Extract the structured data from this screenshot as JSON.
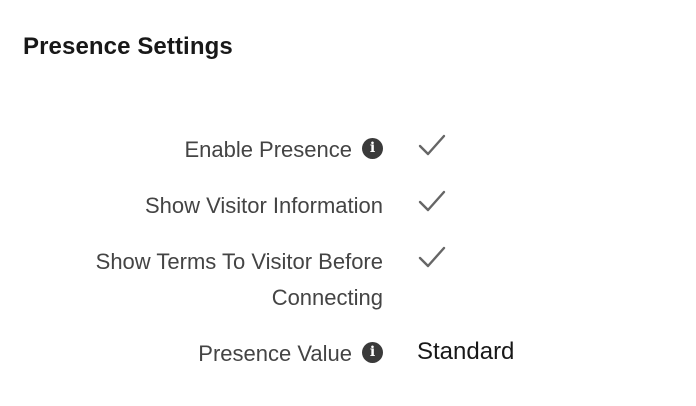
{
  "section": {
    "title": "Presence Settings"
  },
  "fields": {
    "enable_presence": {
      "label": "Enable Presence",
      "info_icon": "info-icon",
      "value_icon": "checkmark-icon"
    },
    "show_visitor_information": {
      "label": "Show Visitor Information",
      "value_icon": "checkmark-icon"
    },
    "show_terms": {
      "label_line1": "Show Terms To Visitor Before",
      "label_line2": "Connecting",
      "value_icon": "checkmark-icon"
    },
    "presence_value": {
      "label": "Presence Value",
      "info_icon": "info-icon",
      "value": "Standard"
    }
  },
  "icons": {
    "info_glyph": "i"
  },
  "colors": {
    "title": "#181818",
    "label": "#444444",
    "icon": "#3a3a3a",
    "checkmark": "#666666"
  }
}
